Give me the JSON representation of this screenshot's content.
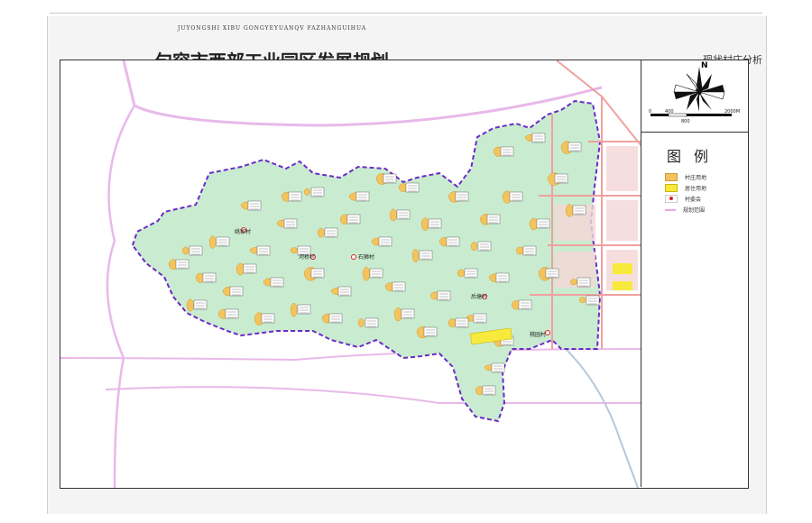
{
  "header": {
    "pinyin": "JUYONGSHI  XIBU  GONGYEYUANQV  FAZHANGUIHUA",
    "title": "句容市西部工业园区发展规划",
    "subtitle": "——现状村庄分析图"
  },
  "compass": {
    "north": "N"
  },
  "scale": {
    "labels": [
      "0",
      "400",
      "800",
      "2000M"
    ]
  },
  "legend": {
    "title": "图例",
    "items": [
      {
        "label": "村庄用地",
        "color": "#f3c45e"
      },
      {
        "label": "居住用地",
        "color": "#f7ea3c"
      },
      {
        "label": "村委会",
        "color": "#e02020"
      },
      {
        "label": "规划范围",
        "color": "#e6a8ea"
      }
    ]
  },
  "colors": {
    "park": "#c9ecd0",
    "boundary": "#6a2bc8",
    "road_pink": "#e8b9ea",
    "road_red": "#f0a0a0",
    "water": "#9ab8d8"
  },
  "places": [
    {
      "name": "姚家村"
    },
    {
      "name": "河桥村"
    },
    {
      "name": "石狮村"
    },
    {
      "name": "后塘村"
    },
    {
      "name": "桃园村"
    }
  ]
}
